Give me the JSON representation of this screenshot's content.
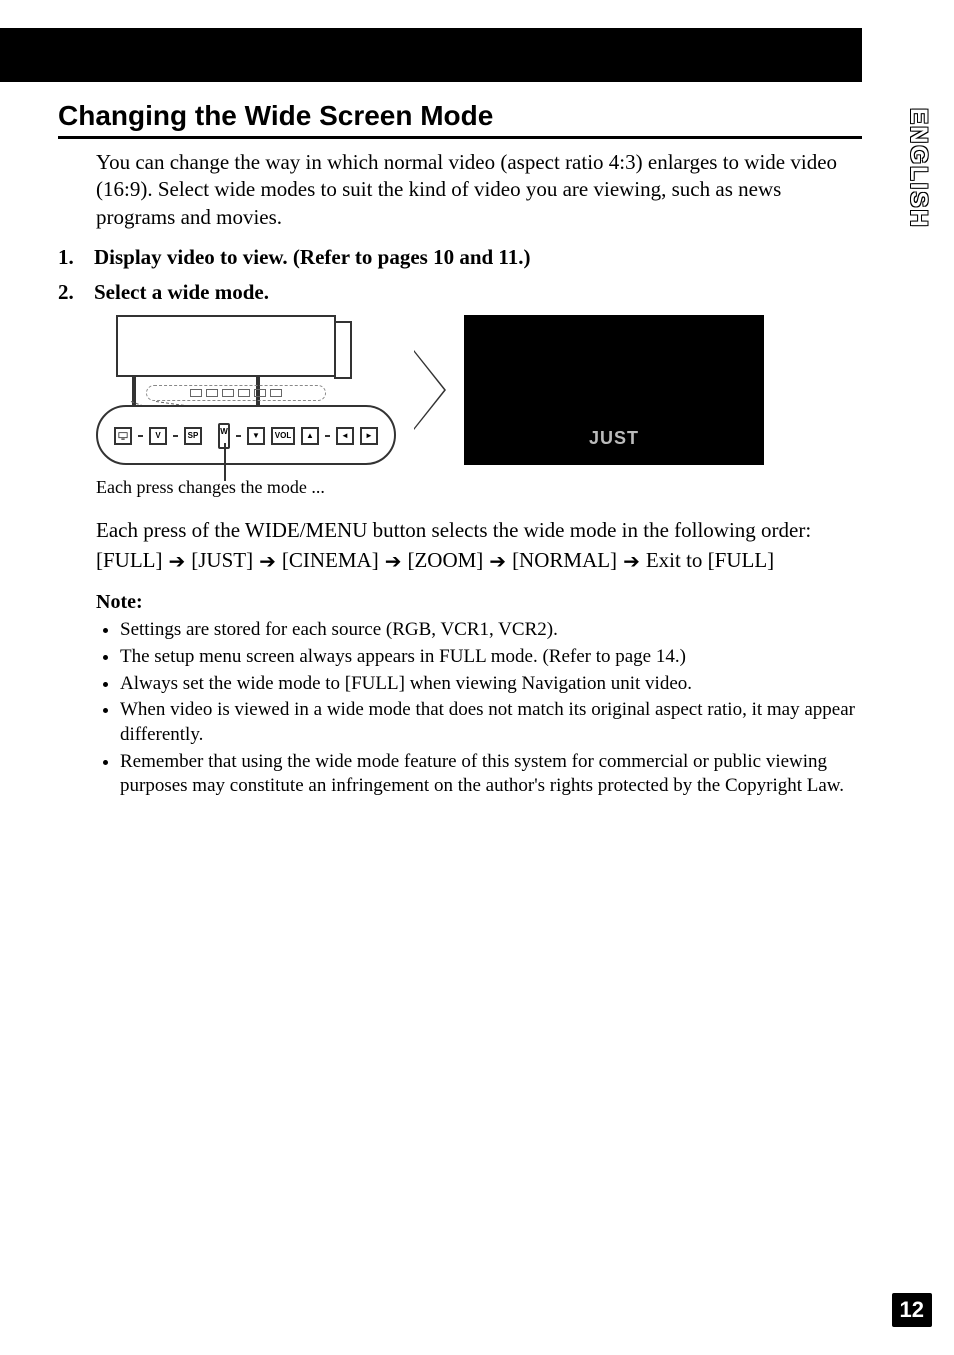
{
  "language_tab": "ENGLISH",
  "page_number": "12",
  "section_title": "Changing the Wide Screen Mode",
  "intro": "You can change the way in which normal video (aspect ratio 4:3) enlarges to wide video (16:9). Select wide modes to suit the kind of video you are viewing, such as news programs and movies.",
  "steps": [
    {
      "num": "1.",
      "text": "Display video to view. (Refer to pages 10 and 11.)"
    },
    {
      "num": "2.",
      "text": "Select a wide mode."
    }
  ],
  "device_keys": {
    "disp": "",
    "v": "V",
    "sp": "SP",
    "w": "W",
    "vol_down": "▼",
    "vol_label": "VOL",
    "vol_up": "▲",
    "left": "◄",
    "right": "►"
  },
  "osd_label": "JUST",
  "caption": "Each press changes the mode ...",
  "order_line": "Each press of the WIDE/MENU button selects the wide mode in the following order:",
  "modes": [
    "[FULL]",
    "[JUST]",
    "[CINEMA]",
    "[ZOOM]",
    "[NORMAL]"
  ],
  "modes_exit": "Exit to [FULL]",
  "arrow_glyph": "➔",
  "note_heading": "Note:",
  "notes": [
    "Settings are stored for each source (RGB, VCR1, VCR2).",
    "The setup menu screen always appears in FULL mode. (Refer to page 14.)",
    "Always set the wide mode to [FULL] when viewing Navigation unit video.",
    "When video is viewed in a wide mode that does not match its original aspect ratio, it may appear differently.",
    "Remember that using the wide mode feature of this system for commercial or public viewing purposes may constitute an infringement on the author's rights protected by the Copyright Law."
  ]
}
